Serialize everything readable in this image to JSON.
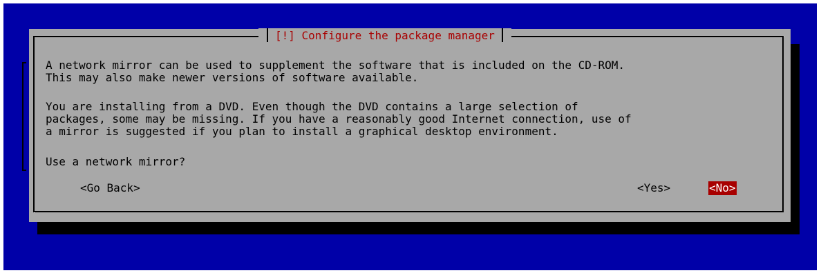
{
  "dialog": {
    "title": "[!] Configure the package manager",
    "paragraph1": [
      "A network mirror can be used to supplement the software that is included on the CD-ROM.",
      "This may also make newer versions of software available."
    ],
    "paragraph2": [
      "You are installing from a DVD. Even though the DVD contains a large selection of",
      "packages, some may be missing. If you have a reasonably good Internet connection, use of",
      "a mirror is suggested if you plan to install a graphical desktop environment."
    ],
    "question": "Use a network mirror?",
    "buttons": {
      "go_back": "<Go Back>",
      "yes": "<Yes>",
      "no": "<No>"
    }
  },
  "colors": {
    "background": "#0000a8",
    "dialog": "#a8a8a8",
    "title": "#a80000",
    "focus": "#a80000"
  }
}
